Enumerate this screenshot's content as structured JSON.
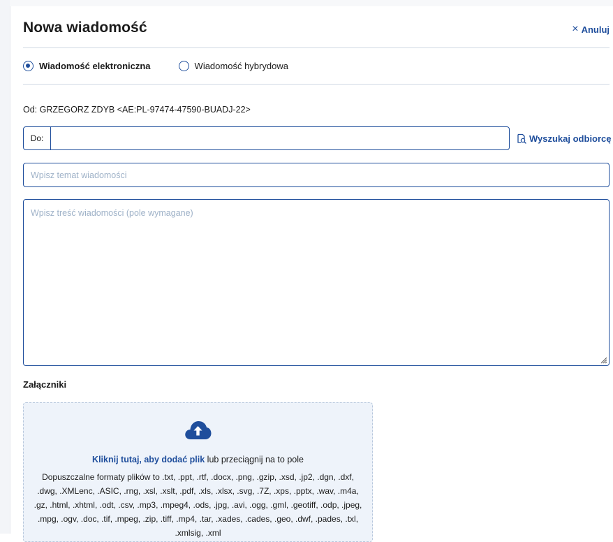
{
  "header": {
    "title": "Nowa wiadomość",
    "cancel_label": "Anuluj",
    "cancel_icon": "×"
  },
  "message_type": {
    "options": [
      {
        "label": "Wiadomość elektroniczna",
        "selected": true
      },
      {
        "label": "Wiadomość hybrydowa",
        "selected": false
      }
    ]
  },
  "from": {
    "text": "Od: GRZEGORZ ZDYB <AE:PL-97474-47590-BUADJ-22>"
  },
  "to": {
    "label": "Do:",
    "value": "",
    "search_label": "Wyszukaj odbiorcę"
  },
  "subject": {
    "placeholder": "Wpisz temat wiadomości",
    "value": ""
  },
  "body": {
    "placeholder": "Wpisz treść wiadomości (pole wymagane)",
    "value": ""
  },
  "attachments": {
    "title": "Załączniki",
    "link_text": "Kliknij tutaj, aby dodać plik",
    "drop_text": " lub przeciągnij na to pole",
    "formats_text": "Dopuszczalne formaty plików to .txt, .ppt, .rtf, .docx, .png, .gzip, .xsd, .jp2, .dgn, .dxf, .dwg, .XMLenc, .ASIC, .rng, .xsl, .xslt, .pdf, .xls, .xlsx, .svg, .7Z, .xps, .pptx, .wav, .m4a, .gz, .html, .xhtml, .odt, .csv, .mp3, .mpeg4, .ods, .jpg, .avi, .ogg, .gml, .geotiff, .odp, .jpeg, .mpg, .ogv, .doc, .tif, .mpeg, .zip, .tiff, .mp4, .tar, .xades, .cades, .geo, .dwf, .pades, .txl, .xmlsig, .xml"
  },
  "colors": {
    "accent": "#1f4e9c",
    "placeholder": "#9fb2c8",
    "dropzone_bg": "#eef3fa"
  }
}
